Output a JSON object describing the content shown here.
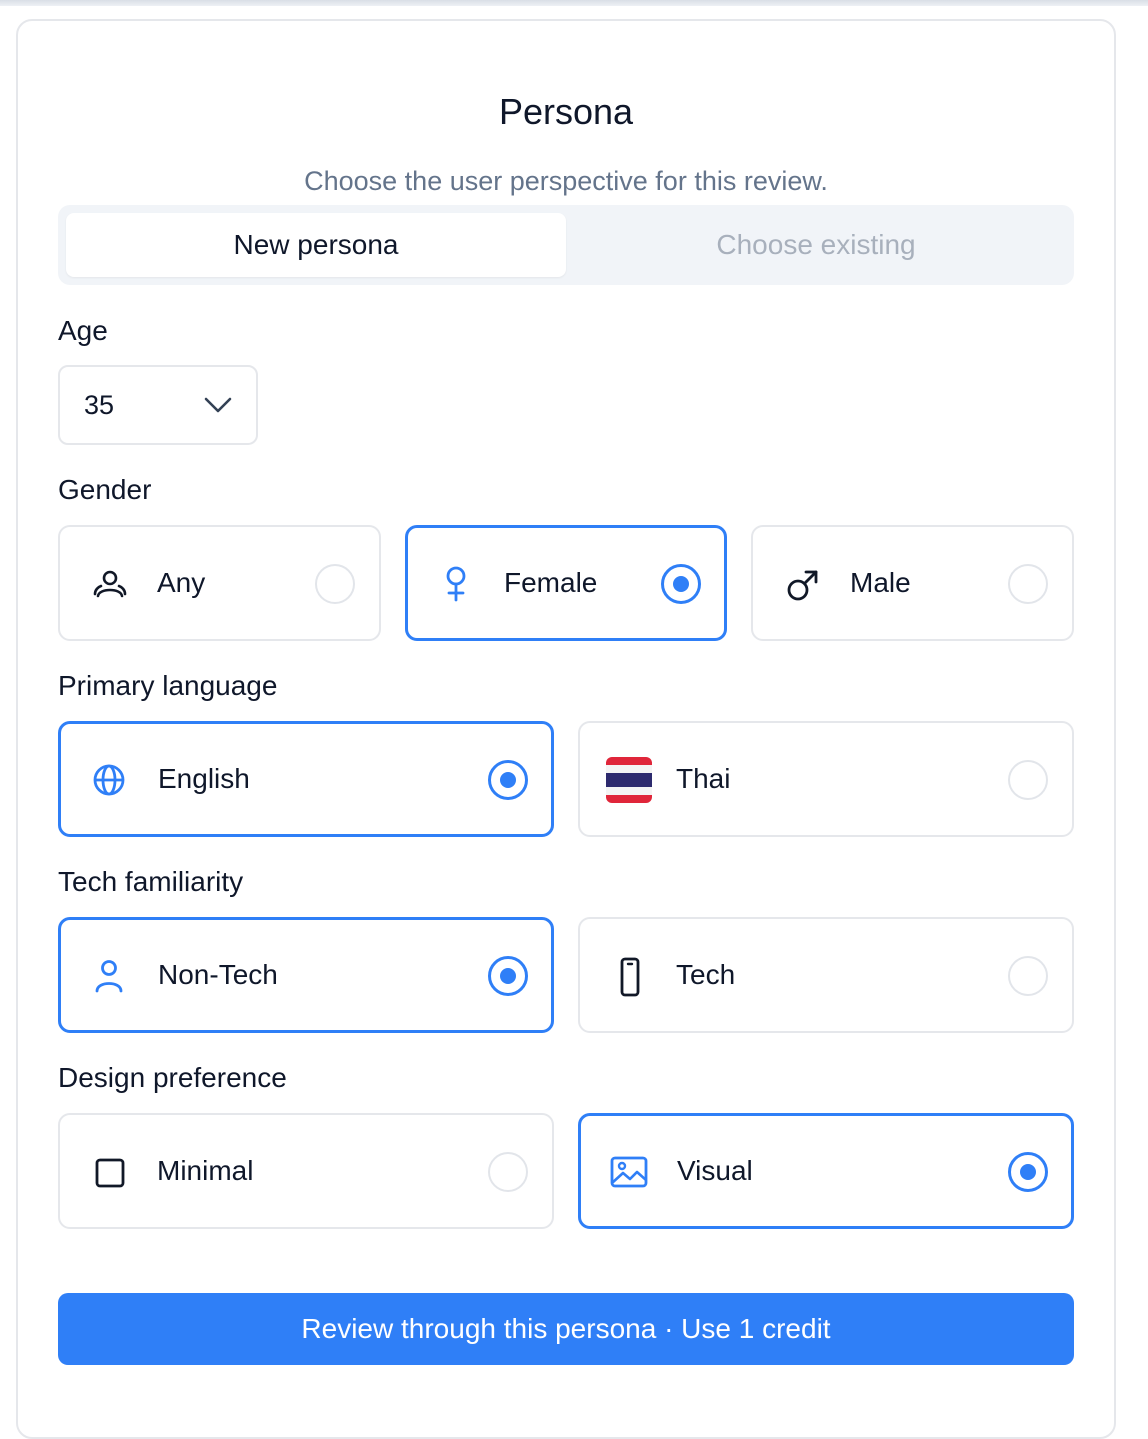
{
  "header": {
    "title": "Persona",
    "subtitle": "Choose the user perspective for this review."
  },
  "tabs": {
    "new": "New persona",
    "existing": "Choose existing",
    "active": "new"
  },
  "age": {
    "label": "Age",
    "value": "35"
  },
  "gender": {
    "label": "Gender",
    "options": [
      {
        "label": "Any",
        "icon": "people-icon",
        "selected": false
      },
      {
        "label": "Female",
        "icon": "female-icon",
        "selected": true
      },
      {
        "label": "Male",
        "icon": "male-icon",
        "selected": false
      }
    ]
  },
  "language": {
    "label": "Primary language",
    "options": [
      {
        "label": "English",
        "icon": "globe-icon",
        "selected": true
      },
      {
        "label": "Thai",
        "icon": "thai-flag-icon",
        "selected": false
      }
    ]
  },
  "tech": {
    "label": "Tech familiarity",
    "options": [
      {
        "label": "Non-Tech",
        "icon": "user-icon",
        "selected": true
      },
      {
        "label": "Tech",
        "icon": "phone-icon",
        "selected": false
      }
    ]
  },
  "design": {
    "label": "Design preference",
    "options": [
      {
        "label": "Minimal",
        "icon": "square-icon",
        "selected": false
      },
      {
        "label": "Visual",
        "icon": "image-icon",
        "selected": true
      }
    ]
  },
  "cta": {
    "label": "Review through this persona · Use 1 credit"
  },
  "colors": {
    "accent": "#2f7ff7",
    "border": "#e5e7eb",
    "muted_text": "#64748b"
  }
}
